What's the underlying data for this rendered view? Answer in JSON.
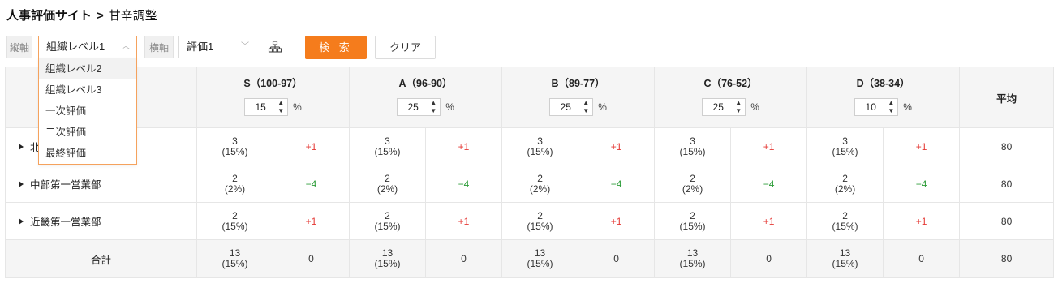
{
  "breadcrumb": {
    "root": "人事評価サイト",
    "separator": ">",
    "current": "甘辛調整"
  },
  "toolbar": {
    "vertical_label": "縦軸",
    "vertical_value": "組織レベル1",
    "horizontal_label": "横軸",
    "horizontal_value": "評価1",
    "search_label": "検 索",
    "clear_label": "クリア"
  },
  "dropdown": {
    "highlighted_index": 0,
    "options": [
      "組織レベル2",
      "組織レベル3",
      "一次評価",
      "二次評価",
      "最終評価"
    ]
  },
  "table": {
    "average_header": "平均",
    "percent_sign": "%",
    "grades": [
      {
        "title": "S（100-97）",
        "percent": "15"
      },
      {
        "title": "A（96-90）",
        "percent": "25"
      },
      {
        "title": "B（89-77）",
        "percent": "25"
      },
      {
        "title": "C（76-52）",
        "percent": "25"
      },
      {
        "title": "D（38-34）",
        "percent": "10"
      }
    ],
    "rows": [
      {
        "name": "北",
        "cells": [
          {
            "count": "3",
            "pct": "(15%)",
            "diff": "+1"
          },
          {
            "count": "3",
            "pct": "(15%)",
            "diff": "+1"
          },
          {
            "count": "3",
            "pct": "(15%)",
            "diff": "+1"
          },
          {
            "count": "3",
            "pct": "(15%)",
            "diff": "+1"
          },
          {
            "count": "3",
            "pct": "(15%)",
            "diff": "+1"
          }
        ],
        "avg": "80"
      },
      {
        "name": "中部第一営業部",
        "cells": [
          {
            "count": "2",
            "pct": "(2%)",
            "diff": "−4"
          },
          {
            "count": "2",
            "pct": "(2%)",
            "diff": "−4"
          },
          {
            "count": "2",
            "pct": "(2%)",
            "diff": "−4"
          },
          {
            "count": "2",
            "pct": "(2%)",
            "diff": "−4"
          },
          {
            "count": "2",
            "pct": "(2%)",
            "diff": "−4"
          }
        ],
        "avg": "80"
      },
      {
        "name": "近畿第一営業部",
        "cells": [
          {
            "count": "2",
            "pct": "(15%)",
            "diff": "+1"
          },
          {
            "count": "2",
            "pct": "(15%)",
            "diff": "+1"
          },
          {
            "count": "2",
            "pct": "(15%)",
            "diff": "+1"
          },
          {
            "count": "2",
            "pct": "(15%)",
            "diff": "+1"
          },
          {
            "count": "2",
            "pct": "(15%)",
            "diff": "+1"
          }
        ],
        "avg": "80"
      }
    ],
    "total": {
      "name": "合計",
      "cells": [
        {
          "count": "13",
          "pct": "(15%)",
          "diff": "0"
        },
        {
          "count": "13",
          "pct": "(15%)",
          "diff": "0"
        },
        {
          "count": "13",
          "pct": "(15%)",
          "diff": "0"
        },
        {
          "count": "13",
          "pct": "(15%)",
          "diff": "0"
        },
        {
          "count": "13",
          "pct": "(15%)",
          "diff": "0"
        }
      ],
      "avg": "80"
    }
  },
  "colors": {
    "accent": "#f57c1c",
    "positive_diff": "#e53935",
    "negative_diff": "#2e9d3a",
    "header_bg": "#f5f5f5"
  }
}
